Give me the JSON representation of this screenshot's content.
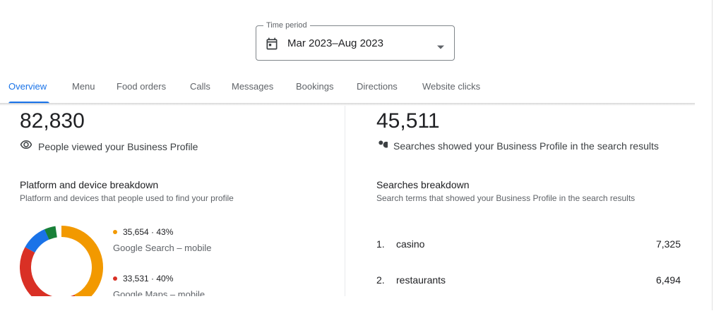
{
  "time_period": {
    "label": "Time period",
    "value": "Mar 2023–Aug 2023",
    "icon": "calendar-icon"
  },
  "tabs": [
    {
      "label": "Overview",
      "active": true
    },
    {
      "label": "Menu"
    },
    {
      "label": "Food orders"
    },
    {
      "label": "Calls"
    },
    {
      "label": "Messages"
    },
    {
      "label": "Bookings"
    },
    {
      "label": "Directions"
    },
    {
      "label": "Website clicks"
    }
  ],
  "profile_views": {
    "count": "82,830",
    "description": "People viewed your Business Profile",
    "icon": "eye-icon"
  },
  "platform_breakdown": {
    "title": "Platform and device breakdown",
    "subtitle": "Platform and devices that people used to find your profile",
    "items": [
      {
        "value": "35,654 · 43%",
        "label": "Google Search – mobile",
        "color": "#f29900"
      },
      {
        "value": "33,531 · 40%",
        "label": "Google Maps – mobile",
        "color": "#d93025"
      }
    ]
  },
  "searches": {
    "count": "45,511",
    "description": "Searches showed your Business Profile in the search results",
    "icon": "search-icon"
  },
  "searches_breakdown": {
    "title": "Searches breakdown",
    "subtitle": "Search terms that showed your Business Profile in the search results",
    "rows": [
      {
        "rank": "1.",
        "term": "casino",
        "count": "7,325"
      },
      {
        "rank": "2.",
        "term": "restaurants",
        "count": "6,494"
      }
    ]
  },
  "colors": {
    "accent": "#1a73e8",
    "donut_orange": "#f29900",
    "donut_red": "#d93025",
    "donut_blue": "#1a73e8",
    "donut_green": "#188038"
  }
}
